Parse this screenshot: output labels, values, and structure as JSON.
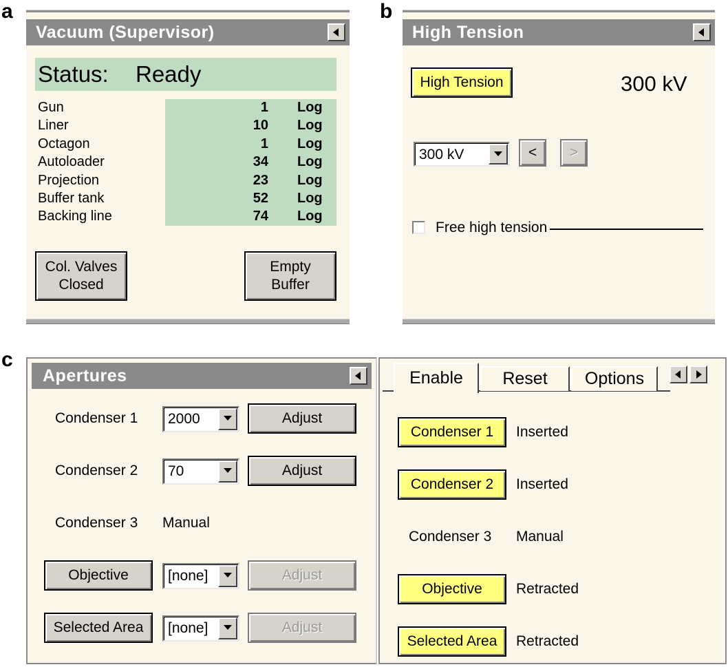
{
  "figure_labels": {
    "a": "a",
    "b": "b",
    "c": "c"
  },
  "vacuum": {
    "title": "Vacuum (Supervisor)",
    "status_label": "Status:",
    "status_value": "Ready",
    "gauges": [
      {
        "name": "Gun",
        "value": "1",
        "log": "Log"
      },
      {
        "name": "Liner",
        "value": "10",
        "log": "Log"
      },
      {
        "name": "Octagon",
        "value": "1",
        "log": "Log"
      },
      {
        "name": "Autoloader",
        "value": "34",
        "log": "Log"
      },
      {
        "name": "Projection",
        "value": "23",
        "log": "Log"
      },
      {
        "name": "Buffer tank",
        "value": "52",
        "log": "Log"
      },
      {
        "name": "Backing line",
        "value": "74",
        "log": "Log"
      }
    ],
    "col_valves_line1": "Col. Valves",
    "col_valves_line2": "Closed",
    "empty_buffer_line1": "Empty",
    "empty_buffer_line2": "Buffer"
  },
  "high_tension": {
    "title": "High Tension",
    "button_label": "High Tension",
    "value": "300 kV",
    "select_value": "300 kV",
    "prev_label": "<",
    "next_label": ">",
    "free_ht_label": "Free high tension",
    "free_ht_checked": false
  },
  "apertures": {
    "title": "Apertures",
    "rows": [
      {
        "name": "Condenser 1",
        "select": "2000",
        "adjust": "Adjust",
        "adjust_enabled": true
      },
      {
        "name": "Condenser 2",
        "select": "70",
        "adjust": "Adjust",
        "adjust_enabled": true
      },
      {
        "name": "Condenser 3",
        "mode": "Manual"
      },
      {
        "name": "Objective",
        "select": "[none]",
        "adjust": "Adjust",
        "adjust_enabled": false
      },
      {
        "name": "Selected Area",
        "select": "[none]",
        "adjust": "Adjust",
        "adjust_enabled": false
      }
    ]
  },
  "enable_panel": {
    "tabs": [
      "Enable",
      "Reset",
      "Options"
    ],
    "active_tab": "Enable",
    "rows": [
      {
        "name": "Condenser 1",
        "state": "Inserted"
      },
      {
        "name": "Condenser 2",
        "state": "Inserted"
      },
      {
        "name": "Condenser 3",
        "state": "Manual"
      },
      {
        "name": "Objective",
        "state": "Retracted"
      },
      {
        "name": "Selected Area",
        "state": "Retracted"
      }
    ]
  },
  "colors": {
    "panel_bg": "#fbf6ea",
    "titlebar": "#8a8a8a",
    "status_green": "#bfdcc2",
    "button_yellow": "#ffff80",
    "button_gray": "#d6d3cc"
  }
}
